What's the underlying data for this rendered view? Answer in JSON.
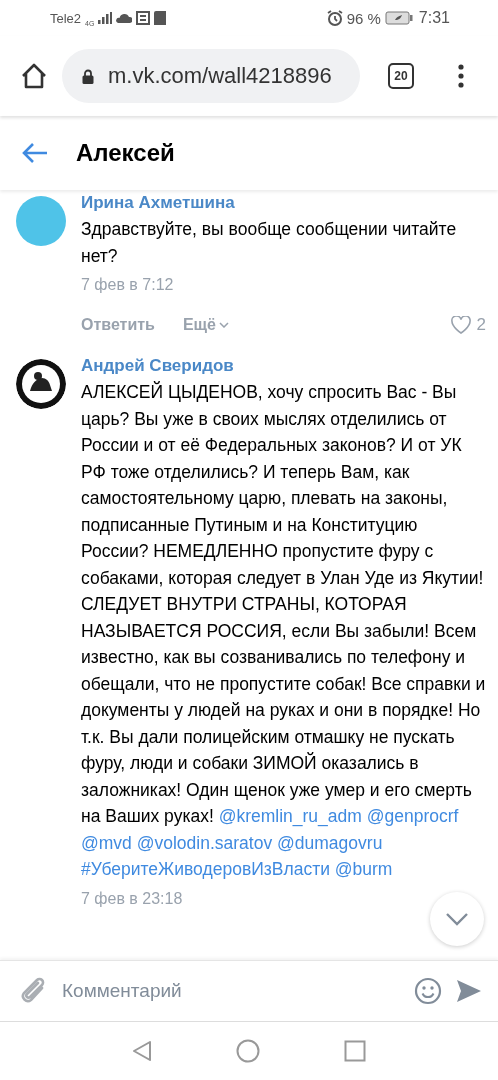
{
  "status_bar": {
    "carrier": "Tele2",
    "network": "4G",
    "battery": "96 %",
    "time": "7:31"
  },
  "browser": {
    "url": "m.vk.com/wall4218896",
    "tab_count": "20"
  },
  "header": {
    "title": "Алексей"
  },
  "comments": [
    {
      "author": "Ирина Ахметшина",
      "avatar": {
        "kind": "photo"
      },
      "segments": [
        {
          "kind": "text",
          "text": "Здравствуйте, вы вообще сообщении читайте нет?"
        }
      ],
      "date": "7 фев в 7:12",
      "reply": "Ответить",
      "more": "Ещё",
      "likes": "2"
    },
    {
      "author": "Андрей Сверидов",
      "avatar": {
        "kind": "logo"
      },
      "segments": [
        {
          "kind": "text",
          "text": "АЛЕКСЕЙ ЦЫДЕНОВ, хочу спросить Вас - Вы царь? Вы уже в своих мыслях отделились от России и от её Федеральных законов? И от УК РФ тоже отделились? И теперь Вам, как самостоятельному царю, плевать на законы, подписанные Путиным и на Конституцию России? НЕМЕДЛЕННО пропустите фуру с собаками, которая следует в Улан Уде из Якутии! СЛЕДУЕТ ВНУТРИ СТРАНЫ, КОТОРАЯ НАЗЫВАЕТСЯ РОССИЯ, если Вы забыли! Всем известно, как вы созванивались по телефону и обещали, что не пропустите собак! Все справки и документы у людей на руках и они в порядке! Но т.к. Вы дали полицейским отмашку не пускать фуру, люди и собаки ЗИМОЙ оказались в заложниках! Один щенок уже умер и его смерть на Ваших руках! "
        },
        {
          "kind": "link",
          "text": "@kremlin_ru_adm"
        },
        {
          "kind": "space"
        },
        {
          "kind": "link",
          "text": "@genprocrf"
        },
        {
          "kind": "break"
        },
        {
          "kind": "link",
          "text": "@mvd"
        },
        {
          "kind": "space"
        },
        {
          "kind": "link",
          "text": "@volodin.saratov"
        },
        {
          "kind": "space"
        },
        {
          "kind": "link",
          "text": "@dumagovru"
        },
        {
          "kind": "break"
        },
        {
          "kind": "link",
          "text": "#УберитеЖиводеровИзВласти"
        },
        {
          "kind": "space"
        },
        {
          "kind": "link",
          "text": "@burm"
        }
      ],
      "date": "7 фев в 23:18"
    }
  ],
  "composer": {
    "placeholder": "Комментарий"
  }
}
